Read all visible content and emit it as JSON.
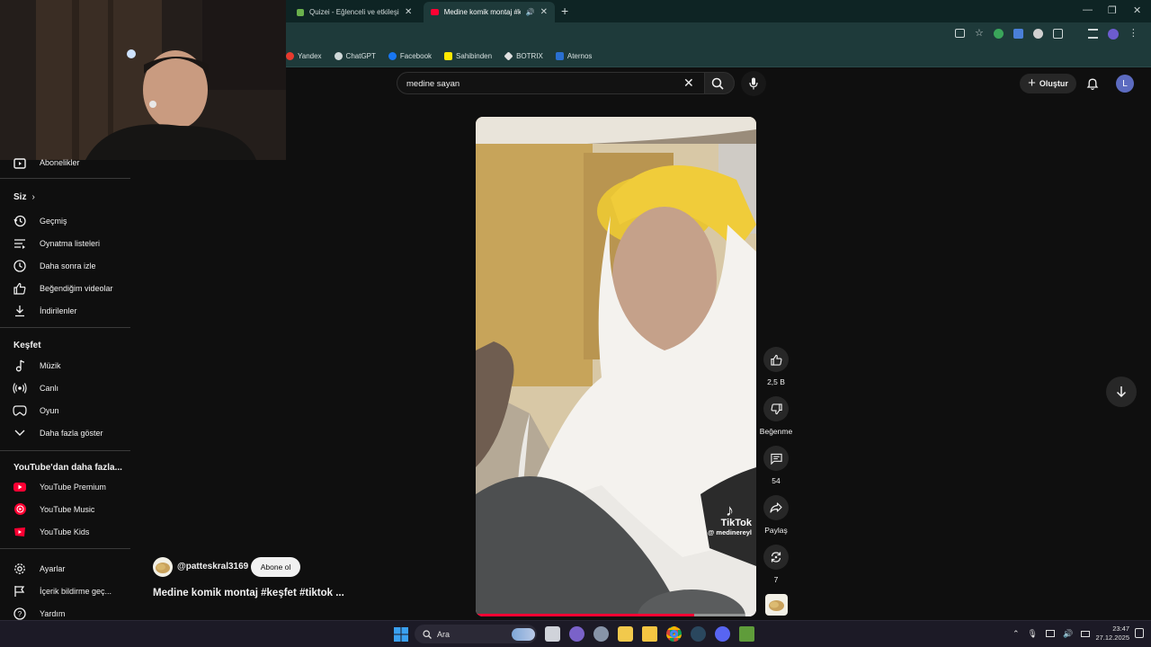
{
  "browser": {
    "tabs": [
      {
        "label": "Quizei - Eğlenceli ve etkileşimli",
        "active": false
      },
      {
        "label": "Medine komik montaj #keşf",
        "active": true
      }
    ],
    "bookmarks": [
      "Yandex",
      "ChatGPT",
      "Facebook",
      "Sahibinden",
      "BOTRIX",
      "Aternos"
    ]
  },
  "sidebar": {
    "subscriptions_label": "Abonelikler",
    "you_header": "Siz",
    "you_items": [
      {
        "icon": "history-icon",
        "label": "Geçmiş"
      },
      {
        "icon": "playlist-icon",
        "label": "Oynatma listeleri"
      },
      {
        "icon": "clock-icon",
        "label": "Daha sonra izle"
      },
      {
        "icon": "thumb-up-icon",
        "label": "Beğendiğim videolar"
      },
      {
        "icon": "download-icon",
        "label": "İndirilenler"
      }
    ],
    "explore_header": "Keşfet",
    "explore_items": [
      {
        "icon": "music-icon",
        "label": "Müzik"
      },
      {
        "icon": "live-icon",
        "label": "Canlı"
      },
      {
        "icon": "gaming-icon",
        "label": "Oyun"
      },
      {
        "icon": "chevron-down-icon",
        "label": "Daha fazla göster"
      }
    ],
    "more_header": "YouTube'dan daha fazla...",
    "more_items": [
      {
        "label": "YouTube Premium"
      },
      {
        "label": "YouTube Music"
      },
      {
        "label": "YouTube Kids"
      }
    ],
    "footer_items": [
      {
        "icon": "gear-icon",
        "label": "Ayarlar"
      },
      {
        "icon": "flag-icon",
        "label": "İçerik bildirme geç..."
      },
      {
        "icon": "help-icon",
        "label": "Yardım"
      }
    ]
  },
  "header": {
    "search_value": "medine sayan",
    "create_label": "Oluştur",
    "avatar_letter": "L"
  },
  "short": {
    "channel": "@patteskral3169",
    "subscribe_label": "Abone ol",
    "title": "Medine komik montaj #keşfet #tiktok ...",
    "watermark_brand": "TikTok",
    "watermark_handle": "@ medinereyl",
    "progress": 0.78
  },
  "actions": {
    "likes": "2,5 B",
    "dislike_label": "Beğenme",
    "comments": "54",
    "share_label": "Paylaş",
    "remix": "7"
  },
  "taskbar": {
    "search_label": "Ara",
    "time": "23:47",
    "date": "27.12.2025"
  },
  "colors": {
    "youtube_red": "#ff0033",
    "page_bg": "#0f0f0f",
    "browser_dark": "#0e2424",
    "browser_light": "#1e3a3a"
  }
}
